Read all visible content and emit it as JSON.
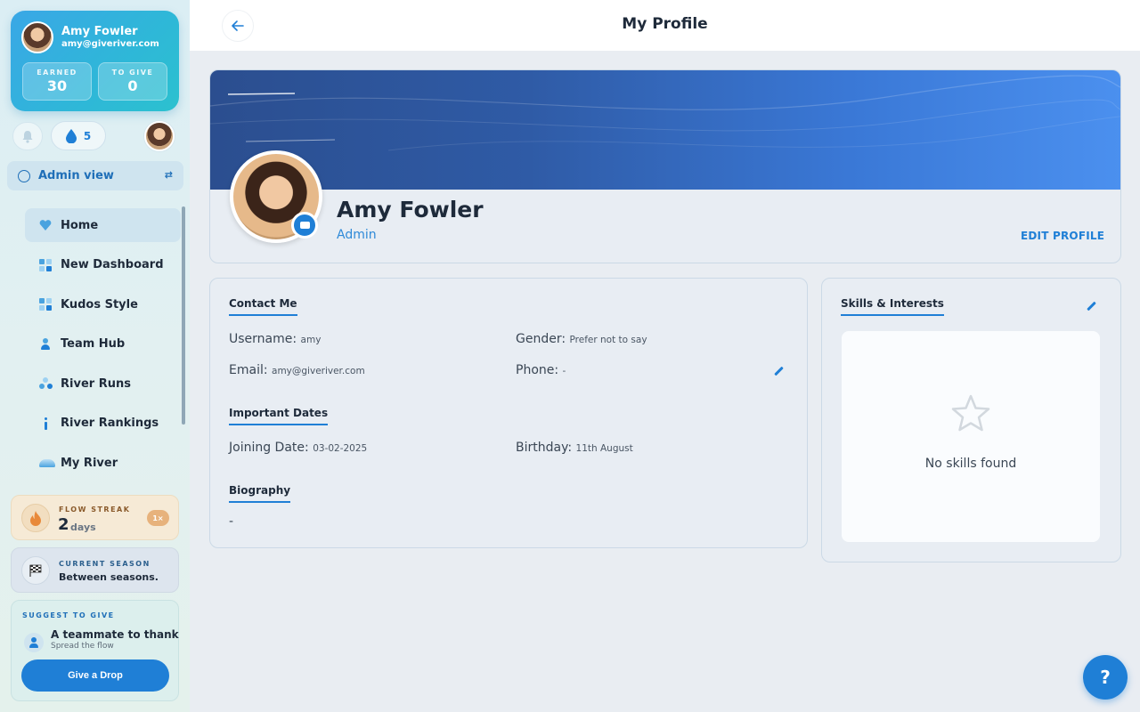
{
  "user": {
    "name": "Amy Fowler",
    "email": "amy@giveriver.com",
    "earned_label": "EARNED",
    "earned_value": "30",
    "to_give_label": "TO GIVE",
    "to_give_value": "0",
    "drops": "5"
  },
  "admin_view": {
    "label": "Admin view"
  },
  "nav": {
    "items": [
      {
        "label": "Home",
        "icon": "heart-icon",
        "active": true
      },
      {
        "label": "New Dashboard",
        "icon": "grid-icon"
      },
      {
        "label": "Kudos Style",
        "icon": "grid-icon"
      },
      {
        "label": "Team Hub",
        "icon": "person-icon"
      },
      {
        "label": "River Runs",
        "icon": "drops-icon"
      },
      {
        "label": "River Rankings",
        "icon": "info-icon"
      },
      {
        "label": "My River",
        "icon": "river-icon"
      }
    ]
  },
  "streak": {
    "label": "FLOW STREAK",
    "value": "2",
    "unit": "days",
    "multiplier": "1×"
  },
  "season": {
    "label": "CURRENT SEASON",
    "value": "Between seasons."
  },
  "suggest": {
    "label": "SUGGEST TO GIVE",
    "title": "A teammate to thank",
    "subtitle": "Spread the flow",
    "button": "Give a Drop"
  },
  "header": {
    "title": "My Profile"
  },
  "profile": {
    "name": "Amy Fowler",
    "role": "Admin",
    "edit_label": "EDIT PROFILE"
  },
  "contact": {
    "title": "Contact Me",
    "username_label": "Username:",
    "username_value": "amy",
    "gender_label": "Gender:",
    "gender_value": "Prefer not to say",
    "email_label": "Email:",
    "email_value": "amy@giveriver.com",
    "phone_label": "Phone:",
    "phone_value": "-"
  },
  "dates": {
    "title": "Important Dates",
    "joining_label": "Joining Date:",
    "joining_value": "03-02-2025",
    "birthday_label": "Birthday:",
    "birthday_value": "11th August"
  },
  "biography": {
    "title": "Biography",
    "value": "-"
  },
  "skills": {
    "title": "Skills & Interests",
    "empty_text": "No skills found"
  },
  "help": {
    "label": "?"
  },
  "colors": {
    "accent": "#1f7fd6",
    "banner_start": "#2b4e8f",
    "banner_end": "#4b90ef"
  }
}
